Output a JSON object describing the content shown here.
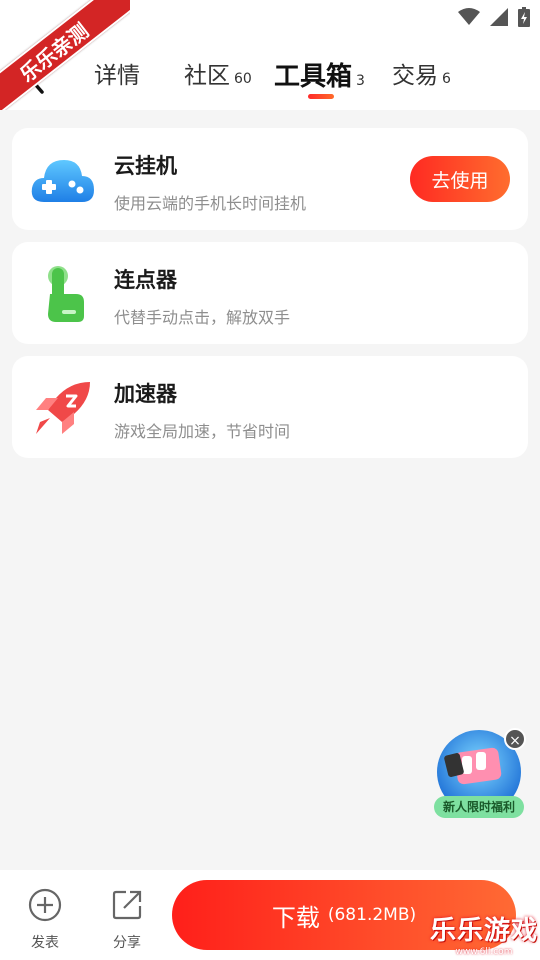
{
  "ribbon": "乐乐亲测",
  "tabs": [
    {
      "label": "详情",
      "count": ""
    },
    {
      "label": "社区",
      "count": "60"
    },
    {
      "label": "工具箱",
      "count": "3"
    },
    {
      "label": "交易",
      "count": "6"
    }
  ],
  "active_tab": "工具箱",
  "tools": [
    {
      "title": "云挂机",
      "desc": "使用云端的手机长时间挂机",
      "icon": "cloud-gamepad-icon",
      "button": "去使用"
    },
    {
      "title": "连点器",
      "desc": "代替手动点击，解放双手",
      "icon": "tap-finger-icon"
    },
    {
      "title": "加速器",
      "desc": "游戏全局加速，节省时间",
      "icon": "rocket-icon"
    }
  ],
  "promo": {
    "label": "新人限时福利",
    "close": "×"
  },
  "bottom": {
    "post_label": "发表",
    "share_label": "分享",
    "download_label": "下载",
    "download_size": "(681.2MB)"
  },
  "watermark": {
    "title": "乐乐游戏",
    "url": "www.6ll.com"
  },
  "colors": {
    "accent": "#ff3a24",
    "background": "#f5f5f5"
  }
}
